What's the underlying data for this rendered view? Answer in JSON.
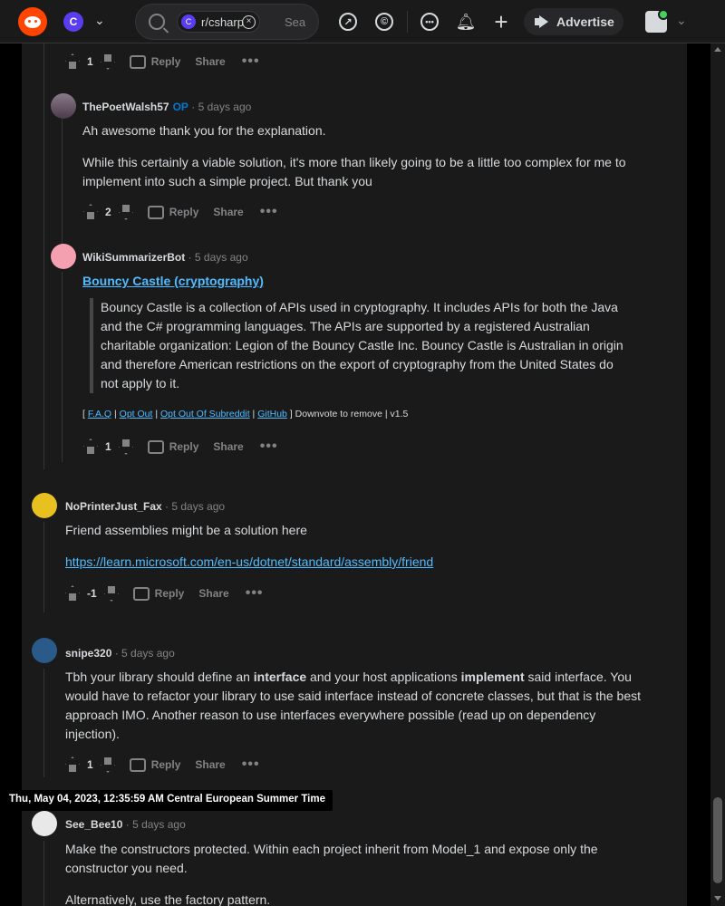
{
  "header": {
    "subreddit": "r/csharp",
    "search_placeholder": "Sea",
    "advertise_label": "Advertise",
    "subreddit_icon_letter": "C"
  },
  "top_actions": {
    "score": "1",
    "reply": "Reply",
    "share": "Share"
  },
  "comments": [
    {
      "author": "ThePoetWalsh57",
      "badge": "OP",
      "time": "· 5 days ago",
      "paragraphs": [
        "Ah awesome thank you for the explanation.",
        "While this certainly a viable solution, it's more than likely going to be a little too complex for me to implement into such a simple project. But thank you"
      ],
      "score": "2",
      "reply": "Reply",
      "share": "Share"
    },
    {
      "author": "WikiSummarizerBot",
      "time": "· 5 days ago",
      "link_title": "Bouncy Castle (cryptography)",
      "quote": "Bouncy Castle is a collection of APIs used in cryptography. It includes APIs for both the Java and the C# programming languages. The APIs are supported by a registered Australian charitable organization: Legion of the Bouncy Castle Inc. Bouncy Castle is Australian in origin and therefore American restrictions on the export of cryptography from the United States do not apply to it.",
      "footer": {
        "open": "[ ",
        "faq": "F.A.Q",
        "opt_out": "Opt Out",
        "opt_out_sub": "Opt Out Of Subreddit",
        "github": "GitHub",
        "tail": " ] Downvote to remove | v1.5",
        "sep": " | "
      },
      "score": "1",
      "reply": "Reply",
      "share": "Share"
    },
    {
      "author": "NoPrinterJust_Fax",
      "time": "· 5 days ago",
      "text": "Friend assemblies might be a solution here",
      "link": "https://learn.microsoft.com/en-us/dotnet/standard/assembly/friend",
      "score": "-1",
      "reply": "Reply",
      "share": "Share"
    },
    {
      "author": "snipe320",
      "time": "· 5 days ago",
      "t1": "Tbh your library should define an ",
      "b1": "interface",
      "t2": " and your host applications ",
      "b2": "implement",
      "t3": " said interface. You would have to refactor your library to use said interface instead of concrete classes, but that is the best approach IMO. Another reason to use interfaces everywhere possible (read up on dependency injection).",
      "score": "1",
      "reply": "Reply",
      "share": "Share"
    },
    {
      "author": "See_Bee10",
      "time": "· 5 days ago",
      "paragraphs": [
        "Make the constructors protected. Within each project inherit from Model_1 and expose only the constructor you need.",
        "Alternatively, use the factory pattern."
      ]
    }
  ],
  "tooltip": "Thu, May 04, 2023, 12:35:59 AM Central European Summer Time"
}
